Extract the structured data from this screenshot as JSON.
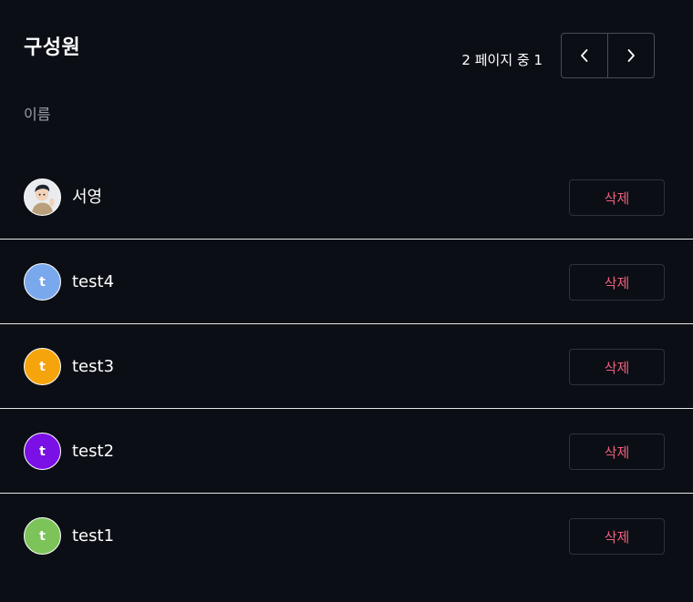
{
  "header": {
    "title": "구성원",
    "pagination_text": "2 페이지 중 1",
    "prev_icon": "chevron-left-icon",
    "next_icon": "chevron-right-icon"
  },
  "table": {
    "column_name": "이름"
  },
  "members": [
    {
      "name": "서영",
      "avatar_type": "photo",
      "avatar_letter": "",
      "avatar_color": "#e9ebee",
      "delete_label": "삭제"
    },
    {
      "name": "test4",
      "avatar_type": "letter",
      "avatar_letter": "t",
      "avatar_color": "#7aa8ec",
      "delete_label": "삭제"
    },
    {
      "name": "test3",
      "avatar_type": "letter",
      "avatar_letter": "t",
      "avatar_color": "#f5a40c",
      "delete_label": "삭제"
    },
    {
      "name": "test2",
      "avatar_type": "letter",
      "avatar_letter": "t",
      "avatar_color": "#7a10e6",
      "delete_label": "삭제"
    },
    {
      "name": "test1",
      "avatar_type": "letter",
      "avatar_letter": "t",
      "avatar_color": "#7cc45a",
      "delete_label": "삭제"
    }
  ],
  "colors": {
    "background": "#0b0e15",
    "delete_text": "#f0607c",
    "divider": "#e6e6e6"
  }
}
